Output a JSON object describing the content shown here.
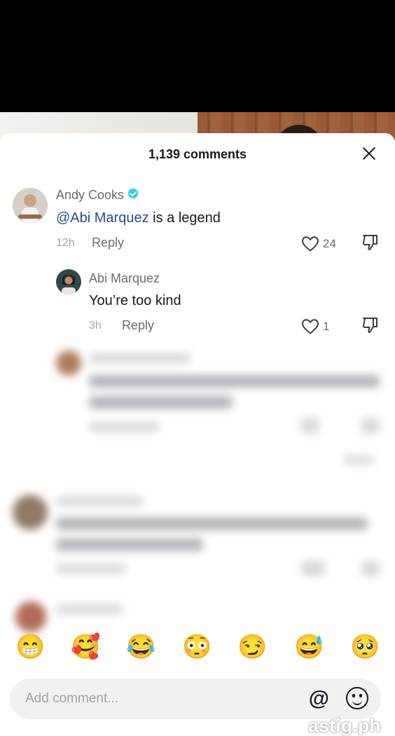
{
  "header": {
    "count_label": "1,139 comments"
  },
  "comments": [
    {
      "username": "Andy Cooks",
      "mention": "@Abi Marquez",
      "text": " is a legend",
      "time": "12h",
      "reply": "Reply",
      "likes": "24"
    },
    {
      "username": "Abi Marquez",
      "text": "You’re too kind",
      "time": "3h",
      "reply": "Reply",
      "likes": "1"
    }
  ],
  "emoji_bar": [
    "😁",
    "🥰",
    "😂",
    "😳",
    "😏",
    "😅",
    "🥺"
  ],
  "input": {
    "placeholder": "Add comment...",
    "at_symbol": "@"
  },
  "watermark": "astig.ph",
  "icons": {
    "verified": "verified-badge-icon",
    "like": "heart-icon",
    "dislike": "thumbs-down-icon",
    "close": "close-icon",
    "emoji": "emoji-face-icon"
  },
  "colors": {
    "mention": "#2b4a8b",
    "verified": "#20d5ec"
  }
}
